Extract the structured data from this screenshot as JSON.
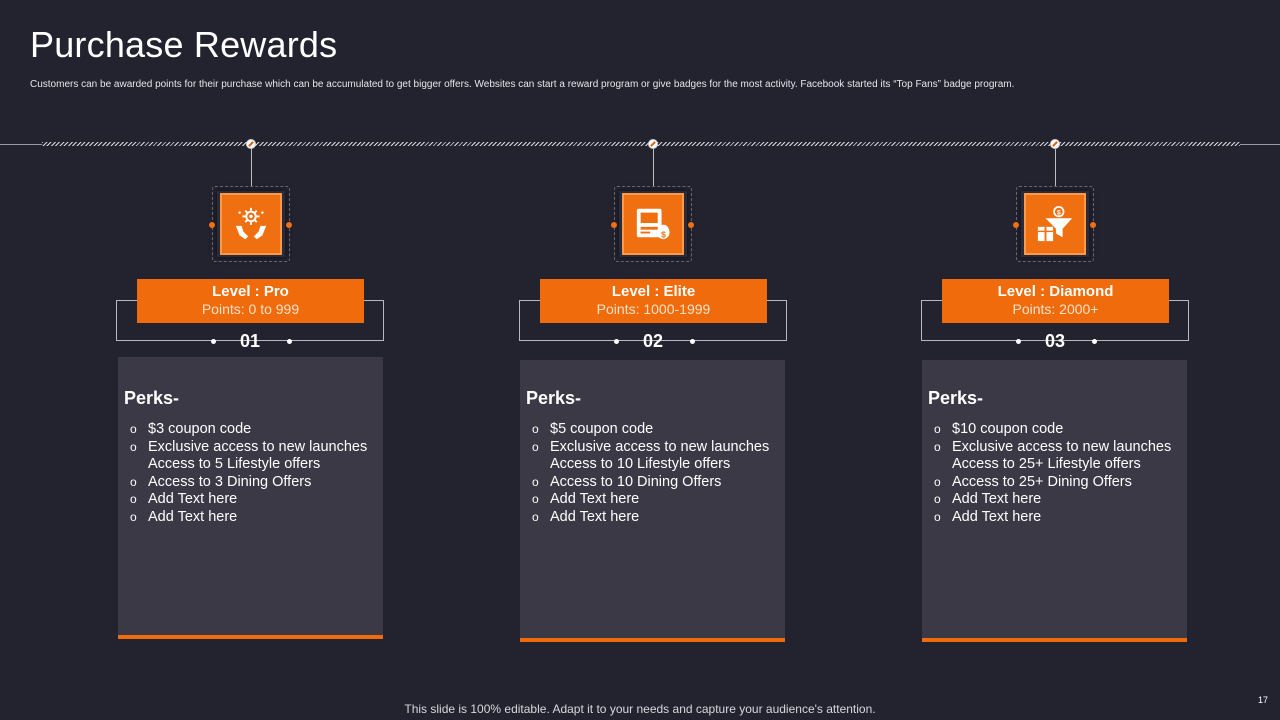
{
  "slide": {
    "title": "Purchase Rewards",
    "subtitle": "Customers can be awarded points for their purchase which can be accumulated to get bigger offers. Websites can start a reward program or give badges for the most activity. Facebook started its “Top Fans” badge program.",
    "footer": "This slide is 100% editable. Adapt it to your needs and capture your audience's attention.",
    "page_number": "17",
    "accent_color": "#f06b0c",
    "background_color": "#23222f"
  },
  "levels": [
    {
      "icon": "hands-gear-icon",
      "name": "Level : Pro",
      "points": "Points: 0 to 999",
      "number": "01",
      "perks_title": "Perks-",
      "perks": [
        "$3 coupon code",
        "Exclusive access to new launches Access to 5 Lifestyle offers",
        "Access to 3 Dining Offers",
        "Add Text here",
        "Add Text here"
      ]
    },
    {
      "icon": "atm-money-icon",
      "name": "Level : Elite",
      "points": "Points: 1000-1999",
      "number": "02",
      "perks_title": "Perks-",
      "perks": [
        "$5 coupon code",
        "Exclusive access to new launches Access to 10 Lifestyle offers",
        "Access to 10 Dining Offers",
        "Add Text here",
        "Add Text here"
      ]
    },
    {
      "icon": "funnel-gift-icon",
      "name": "Level : Diamond",
      "points": "Points: 2000+",
      "number": "03",
      "perks_title": "Perks-",
      "perks": [
        "$10 coupon code",
        "Exclusive access to new launches Access to 25+ Lifestyle offers",
        "Access to 25+ Dining Offers",
        "Add Text here",
        "Add Text here"
      ]
    }
  ],
  "bullet_glyph": "o"
}
